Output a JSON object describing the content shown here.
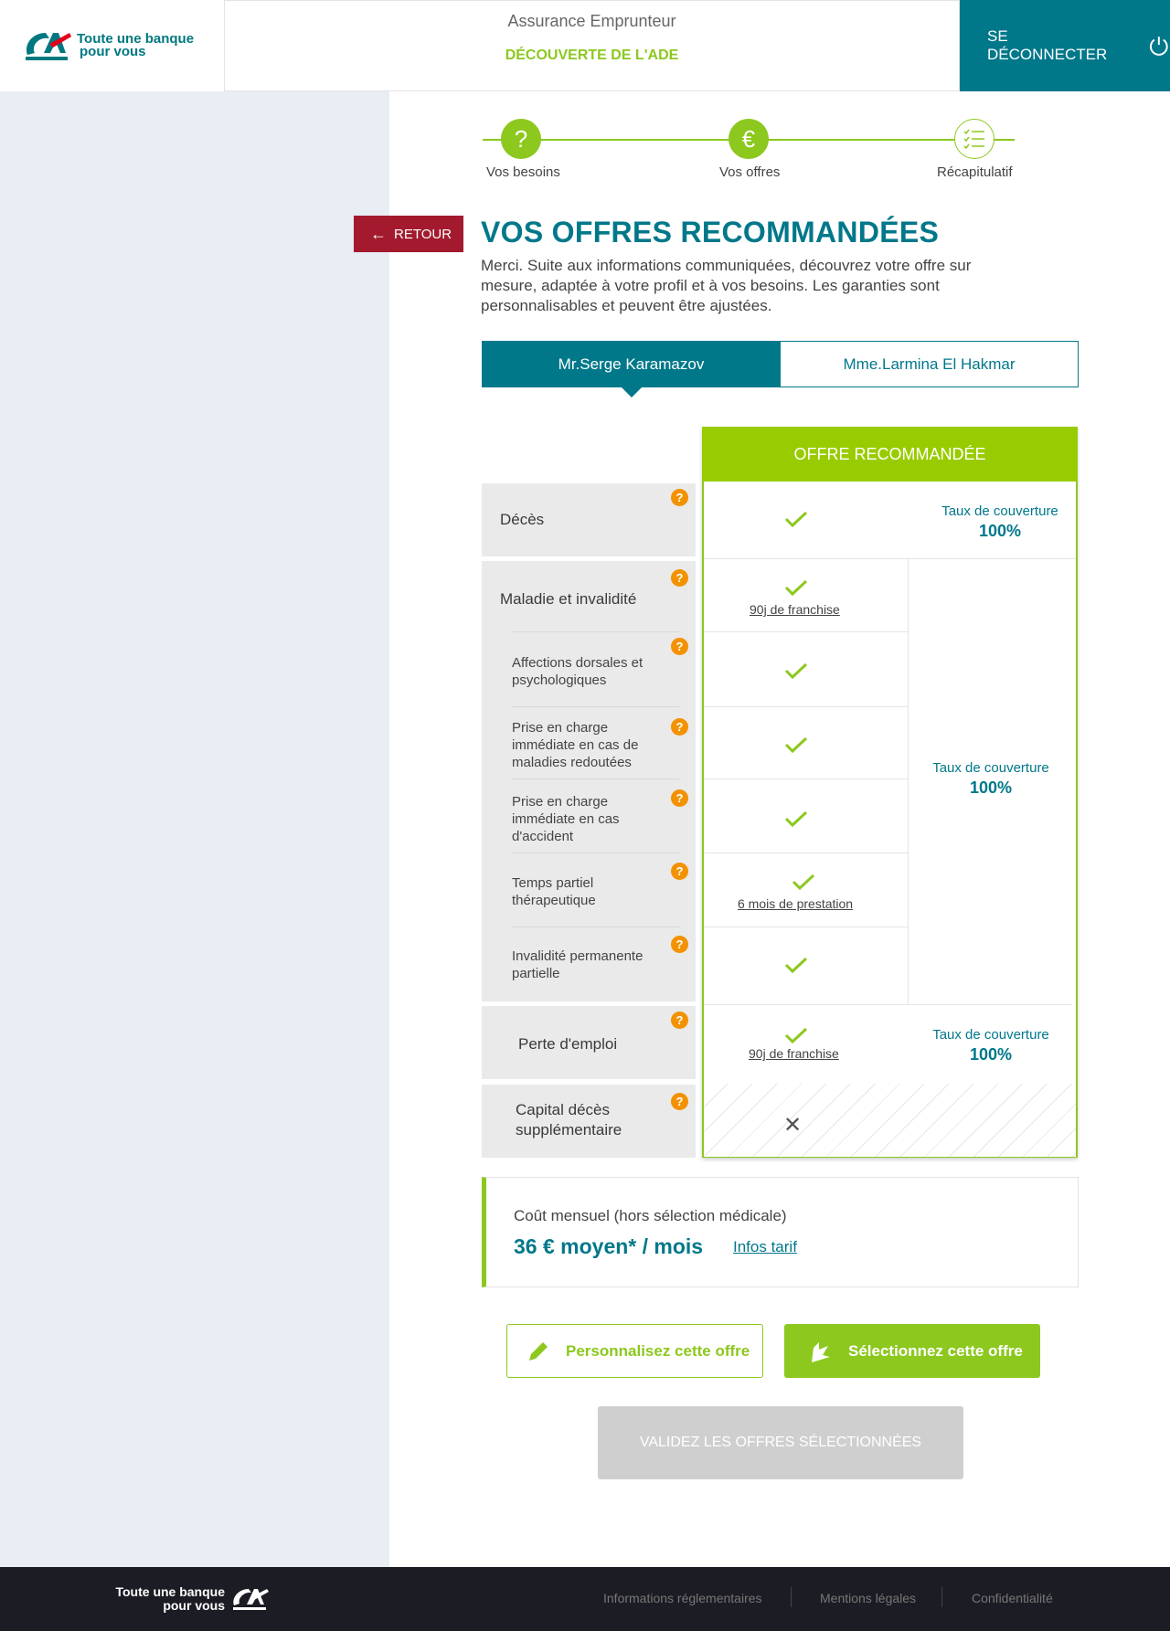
{
  "header": {
    "logo_line1": "Toute une banque",
    "logo_line2": "pour vous",
    "title": "Assurance Emprunteur",
    "subtitle": "DÉCOUVERTE DE L'ADE",
    "logout_label": "SE DÉCONNECTER"
  },
  "stepper": {
    "steps": [
      {
        "label": "Vos besoins",
        "icon": "question-icon",
        "state": "done"
      },
      {
        "label": "Vos offres",
        "icon": "euro-icon",
        "state": "current"
      },
      {
        "label": "Récapitulatif",
        "icon": "checklist-icon",
        "state": "todo"
      }
    ]
  },
  "back_label": "RETOUR",
  "page_title": "VOS OFFRES RECOMMANDÉES",
  "intro": "Merci. Suite aux informations communiquées, découvrez votre offre sur mesure, adaptée à votre profil et à vos besoins. Les garanties sont personnalisables et peuvent être ajustées.",
  "tabs": [
    {
      "label": "Mr.Serge Karamazov",
      "active": true
    },
    {
      "label": "Mme.Larmina El Hakmar",
      "active": false
    }
  ],
  "offer": {
    "header": "OFFRE RECOMMANDÉE",
    "coverage_label": "Taux de couverture",
    "coverage_value": "100%",
    "deces": "Décès",
    "maladie": "Maladie et invalidité",
    "maladie_link": "90j de franchise",
    "subs": [
      "Affections dorsales et psychologiques",
      "Prise en charge immédiate en cas de maladies redoutées",
      "Prise en charge immédiate en cas d'accident",
      "Temps partiel thérapeutique",
      "Invalidité permanente partielle"
    ],
    "temps_partiel_link": "6 mois de prestation",
    "perte": "Perte d'emploi",
    "perte_link": "90j de franchise",
    "capital": "Capital décès supplémentaire"
  },
  "cost": {
    "label": "Coût mensuel (hors sélection médicale)",
    "value": "36 € moyen* / mois",
    "link": "Infos tarif"
  },
  "buttons": {
    "customize": "Personnalisez cette offre",
    "select": "Sélectionnez cette offre",
    "validate": "VALIDEZ LES OFFRES SÉLECTIONNÉES"
  },
  "footer": {
    "logo_line1": "Toute une banque",
    "logo_line2": "pour vous",
    "links": [
      "Informations réglementaires",
      "Mentions légales",
      "Confidentialité"
    ]
  },
  "colors": {
    "teal": "#00788a",
    "green": "#8cc81e",
    "red": "#a31a2e",
    "orange": "#f39200"
  }
}
